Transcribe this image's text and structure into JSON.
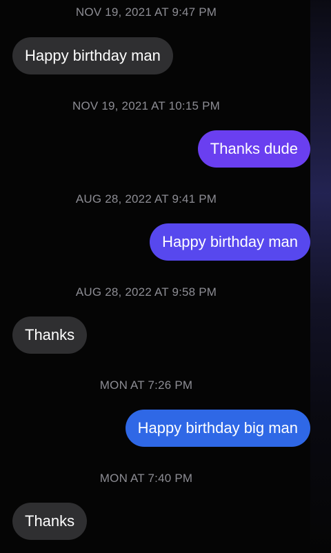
{
  "messages": [
    {
      "timestamp": "NOV 19, 2021 AT 9:47 PM",
      "text": "Happy birthday man",
      "direction": "incoming"
    },
    {
      "timestamp": "NOV 19, 2021 AT 10:15 PM",
      "text": "Thanks dude",
      "direction": "outgoing",
      "color": "#6a3ff0"
    },
    {
      "timestamp": "AUG 28, 2022 AT 9:41 PM",
      "text": "Happy birthday man",
      "direction": "outgoing",
      "color": "#5748ee"
    },
    {
      "timestamp": "AUG 28, 2022 AT 9:58 PM",
      "text": "Thanks",
      "direction": "incoming"
    },
    {
      "timestamp": "MON AT 7:26 PM",
      "text": "Happy birthday big man",
      "direction": "outgoing",
      "color": "#2f68e6"
    },
    {
      "timestamp": "MON AT 7:40 PM",
      "text": "Thanks",
      "direction": "incoming"
    }
  ],
  "colors": {
    "incoming_bubble": "#2f2f31",
    "timestamp_text": "#8d8d94",
    "background": "#050505"
  }
}
